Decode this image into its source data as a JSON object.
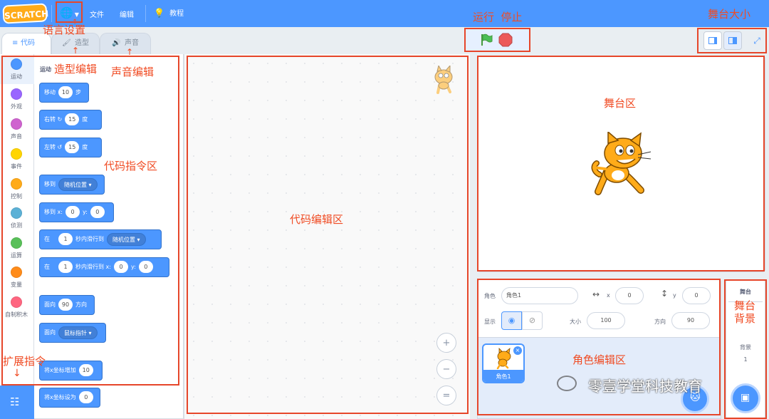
{
  "menubar": {
    "logo": "SCRATCH",
    "file": "文件",
    "edit": "编辑",
    "tutorials": "教程"
  },
  "tabs": {
    "code": "代码",
    "costumes": "造型",
    "sounds": "声音"
  },
  "categories": [
    {
      "label": "运动",
      "color": "#4c97ff"
    },
    {
      "label": "外观",
      "color": "#9966ff"
    },
    {
      "label": "声音",
      "color": "#cf63cf"
    },
    {
      "label": "事件",
      "color": "#ffd500"
    },
    {
      "label": "控制",
      "color": "#ffab19"
    },
    {
      "label": "侦测",
      "color": "#5cb1d6"
    },
    {
      "label": "运算",
      "color": "#59c059"
    },
    {
      "label": "变量",
      "color": "#ff8c1a"
    },
    {
      "label": "自制积木",
      "color": "#ff6680"
    }
  ],
  "palette": {
    "heading": "运动",
    "move": {
      "label": "移动",
      "steps": "10",
      "suffix": "步"
    },
    "turn_right": {
      "label": "右转",
      "degrees": "15",
      "suffix": "度"
    },
    "turn_left": {
      "label": "左转",
      "degrees": "15",
      "suffix": "度"
    },
    "goto": {
      "label": "移到",
      "target": "随机位置"
    },
    "goto_xy": {
      "label": "移到 x:",
      "x": "0",
      "y_label": "y:",
      "y": "0"
    },
    "glide_to": {
      "label": "在",
      "secs": "1",
      "mid": "秒内滑行到",
      "target": "随机位置"
    },
    "glide_xy": {
      "label": "在",
      "secs": "1",
      "mid": "秒内滑行到 x:",
      "x": "0",
      "y_label": "y:",
      "y": "0"
    },
    "point_dir": {
      "label": "面向",
      "dir": "90",
      "suffix": "方向"
    },
    "point_towards": {
      "label": "面向",
      "target": "鼠标指针"
    },
    "change_x": {
      "label": "将x坐标增加",
      "value": "10"
    },
    "set_x": {
      "label": "将x坐标设为",
      "value": "0"
    }
  },
  "zoom": {
    "in": "+",
    "out": "−",
    "reset": "="
  },
  "sprite_info": {
    "sprite_label": "角色",
    "sprite_name": "角色1",
    "x_label": "x",
    "x": "0",
    "y_label": "y",
    "y": "0",
    "show_label": "显示",
    "size_label": "大小",
    "size": "100",
    "direction_label": "方向",
    "direction": "90"
  },
  "sprite_thumb": {
    "name": "角色1"
  },
  "stage_pane": {
    "title": "舞台",
    "backdrops_label": "背景",
    "backdrops_count": "1"
  },
  "annotations": {
    "language": "语言设置",
    "run_stop": "运行  停止",
    "stage_size": "舞台大小",
    "costume_edit": "造型编辑",
    "sound_edit": "声音编辑",
    "code_blocks": "代码指令区",
    "code_editor": "代码编辑区",
    "stage_area": "舞台区",
    "stage_backdrop": "舞台\n背景",
    "sprite_editor": "角色编辑区",
    "extensions": "扩展指令"
  },
  "watermark": "零壹学堂科技教育",
  "colors": {
    "brand": "#4c97ff",
    "annotation": "#f04b23",
    "flag": "#4cbf56",
    "stop": "#ec5959"
  }
}
